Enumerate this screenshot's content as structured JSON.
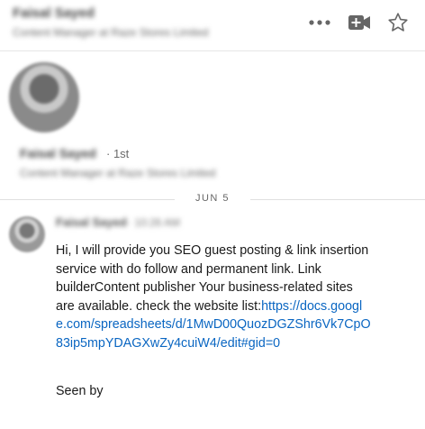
{
  "header": {
    "contact_name": "Faisal Sayed",
    "contact_title": "Content Manager at Raze Stores Limited",
    "actions": {
      "more_icon": "more-horizontal-icon",
      "video_icon": "video-add-icon",
      "star_icon": "star-outline-icon"
    }
  },
  "profile": {
    "name": "Faisal Sayed",
    "degree": "· 1st",
    "title": "Content Manager at Raze Stores Limited"
  },
  "divider": {
    "date": "JUN 5"
  },
  "message": {
    "sender": "Faisal Sayed",
    "time": "· 10:26 AM",
    "text": "Hi, I will provide you SEO guest posting & link insertion service with do follow and permanent link. Link builderContent publisher Your business-related sites are available. check the website list:",
    "link": "https://docs.google.com/spreadsheets/d/1MwD00QuozDGZShr6Vk7CpO83ip5mpYDAGXwZy4cuiW4/edit#gid=0",
    "seen": "Seen by"
  },
  "colors": {
    "link": "#0a66c2",
    "icon": "#666666",
    "divider": "#e0e0e0"
  }
}
